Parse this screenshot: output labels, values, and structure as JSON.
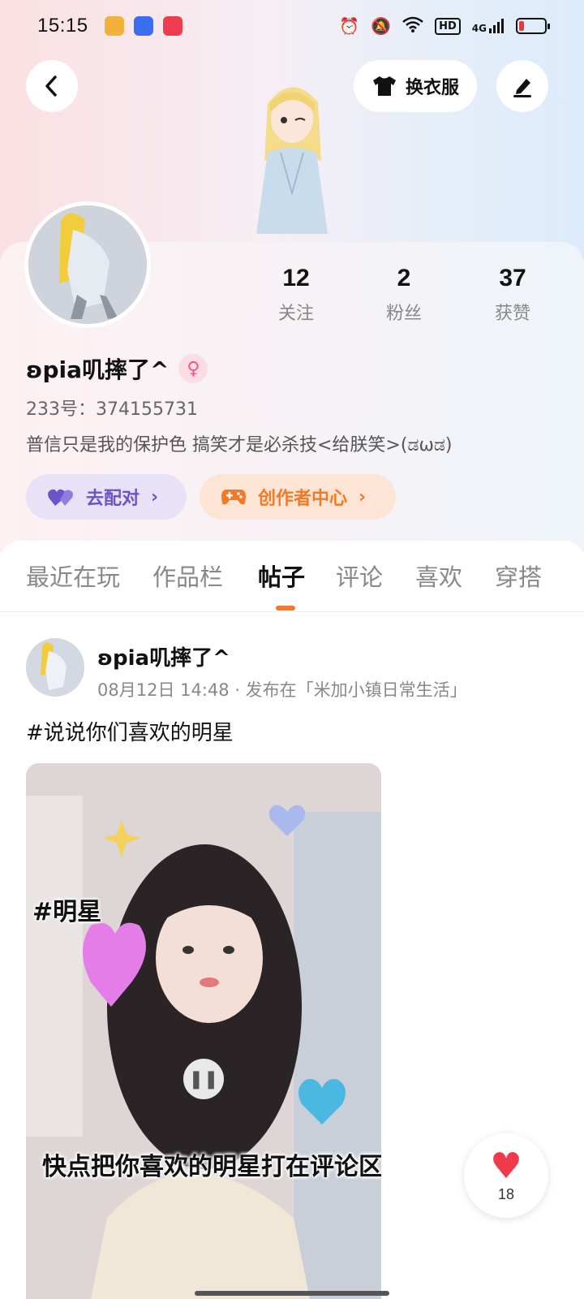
{
  "status_bar": {
    "time": "15:15",
    "hd": "HD",
    "network": "4G",
    "battery_level": 0.12,
    "icons": [
      "alarm-icon",
      "mute-icon",
      "wifi-icon",
      "signal-icon",
      "battery-icon"
    ]
  },
  "header": {
    "back_icon": "back-icon",
    "dress_label": "换衣服",
    "edit_icon": "edit-icon"
  },
  "profile": {
    "stats": [
      {
        "num": "12",
        "label": "关注"
      },
      {
        "num": "2",
        "label": "粉丝"
      },
      {
        "num": "37",
        "label": "获赞"
      }
    ],
    "username": "ʚpia叽摔了^",
    "gender_symbol": "♀",
    "uid_line": "233号：374155731",
    "bio": "普信只是我的保护色  搞笑才是必杀技<给朕笑>(ಡωಡ)",
    "match_label": "去配对",
    "creator_label": "创作者中心"
  },
  "tabs": [
    {
      "label": "最近在玩"
    },
    {
      "label": "作品栏"
    },
    {
      "label": "帖子"
    },
    {
      "label": "评论"
    },
    {
      "label": "喜欢"
    },
    {
      "label": "穿搭"
    }
  ],
  "active_tab": "帖子",
  "post": {
    "author": "ʚpia叽摔了^",
    "meta": "08月12日 14:48 · 发布在「米加小镇日常生活」",
    "text": "#说说你们喜欢的明星",
    "video_tag": "#明星",
    "video_caption": "快点把你喜欢的明星打在评论区吧"
  },
  "like": {
    "count": "18"
  },
  "colors": {
    "accent": "#f07a26",
    "match": "#6a54c8",
    "heart": "#f0394b"
  }
}
